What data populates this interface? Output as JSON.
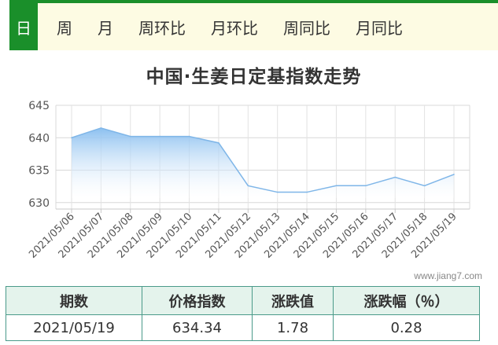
{
  "tabs": {
    "items": [
      {
        "label": "日",
        "active": true
      },
      {
        "label": "周",
        "active": false
      },
      {
        "label": "月",
        "active": false
      },
      {
        "label": "周环比",
        "active": false
      },
      {
        "label": "月环比",
        "active": false
      },
      {
        "label": "周同比",
        "active": false
      },
      {
        "label": "月同比",
        "active": false
      }
    ]
  },
  "watermark": "www.jiang7.com",
  "colors": {
    "accent": "#1a8f2a",
    "line": "#7fb6e8",
    "fill_top": "#8cc0f0",
    "table_header_bg": "#e4f3ec",
    "table_border": "#4a9a8a"
  },
  "chart_data": {
    "type": "area",
    "title": "中国·生姜日定基指数走势",
    "xlabel": "",
    "ylabel": "",
    "ylim": [
      629,
      645
    ],
    "yticks": [
      630,
      635,
      640,
      645
    ],
    "grid": true,
    "categories": [
      "2021/05/06",
      "2021/05/07",
      "2021/05/08",
      "2021/05/09",
      "2021/05/10",
      "2021/05/11",
      "2021/05/12",
      "2021/05/13",
      "2021/05/14",
      "2021/05/15",
      "2021/05/16",
      "2021/05/17",
      "2021/05/18",
      "2021/05/19"
    ],
    "values": [
      640.0,
      641.5,
      640.2,
      640.2,
      640.2,
      639.2,
      632.6,
      631.6,
      631.6,
      632.6,
      632.6,
      633.9,
      632.6,
      634.34
    ]
  },
  "table": {
    "headers": [
      "期数",
      "价格指数",
      "涨跌值",
      "涨跌幅（％）"
    ],
    "rows": [
      [
        "2021/05/19",
        "634.34",
        "1.78",
        "0.28"
      ]
    ]
  }
}
